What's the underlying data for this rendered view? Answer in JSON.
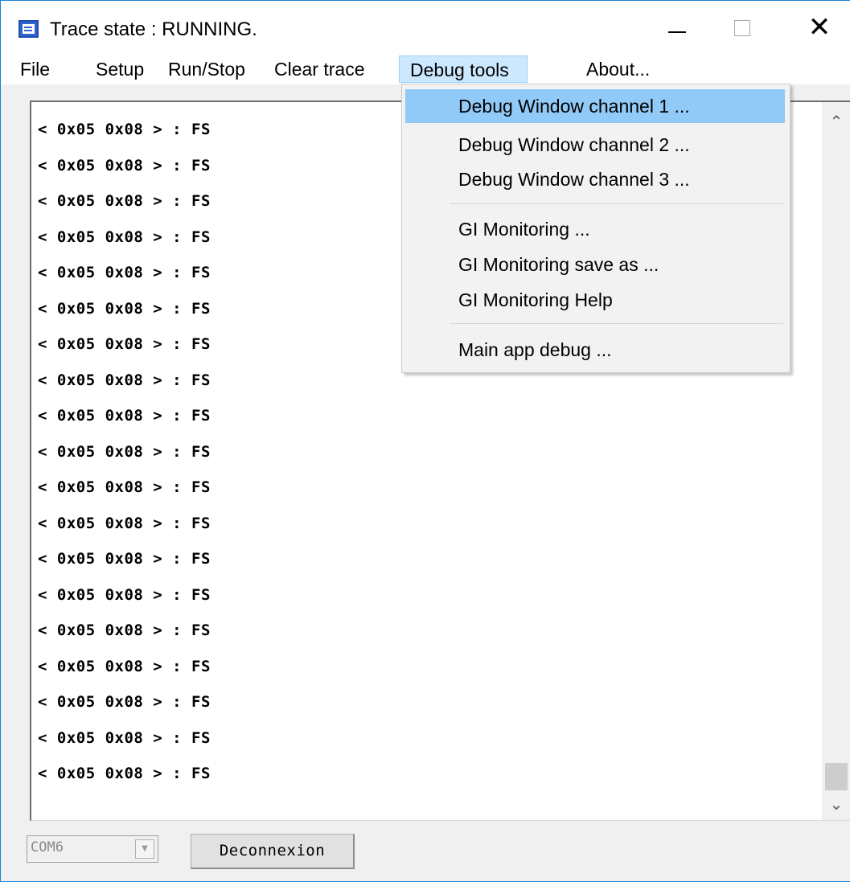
{
  "window": {
    "title": "Trace state : RUNNING.",
    "icon": "app-icon",
    "controls": {
      "minimize": "—",
      "maximize": "□",
      "close": "✕"
    }
  },
  "menubar": {
    "items": [
      {
        "label": "File"
      },
      {
        "label": "Setup"
      },
      {
        "label": "Run/Stop"
      },
      {
        "label": "Clear trace"
      },
      {
        "label": "Debug tools",
        "active": true
      },
      {
        "label": "About..."
      }
    ]
  },
  "dropdown": {
    "items": [
      {
        "label": "Debug Window channel 1 ...",
        "highlighted": true
      },
      {
        "label": "Debug Window channel 2 ..."
      },
      {
        "label": "Debug Window channel 3 ..."
      },
      {
        "label": "GI Monitoring ..."
      },
      {
        "label": "GI Monitoring save as ..."
      },
      {
        "label": "GI Monitoring Help"
      },
      {
        "label": "Main app debug ..."
      }
    ]
  },
  "trace": {
    "lines": [
      "< 0x05 0x08 > : FS",
      "< 0x05 0x08 > : FS",
      "< 0x05 0x08 > : FS",
      "< 0x05 0x08 > : FS",
      "< 0x05 0x08 > : FS",
      "< 0x05 0x08 > : FS",
      "< 0x05 0x08 > : FS",
      "< 0x05 0x08 > : FS",
      "< 0x05 0x08 > : FS",
      "< 0x05 0x08 > : FS",
      "< 0x05 0x08 > : FS",
      "< 0x05 0x08 > : FS",
      "< 0x05 0x08 > : FS",
      "< 0x05 0x08 > : FS",
      "< 0x05 0x08 > : FS",
      "< 0x05 0x08 > : FS",
      "< 0x05 0x08 > : FS",
      "< 0x05 0x08 > : FS",
      "< 0x05 0x08 > : FS"
    ],
    "scroll_up_icon": "chevron-up-icon",
    "scroll_down_icon": "chevron-down-icon"
  },
  "footer": {
    "port_select": {
      "value": "COM6",
      "disabled": true
    },
    "deconnexion_label": "Deconnexion"
  },
  "colors": {
    "menu_active_bg": "#cce8ff",
    "dropdown_highlight": "#91c9f7",
    "window_border": "#1883d7"
  }
}
